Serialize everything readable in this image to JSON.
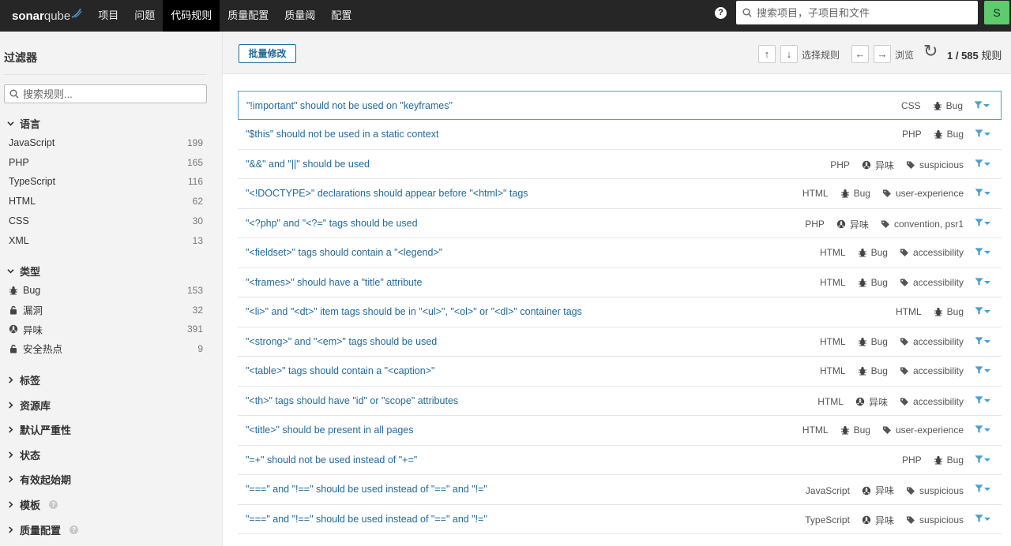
{
  "app": {
    "logo_main": "sonar",
    "logo_qube": "qube"
  },
  "nav": {
    "items": [
      "项目",
      "问题",
      "代码规则",
      "质量配置",
      "质量阈",
      "配置"
    ],
    "active_index": 2,
    "search_placeholder": "搜索项目，子项目和文件",
    "avatar_letter": "S",
    "help": "?"
  },
  "sidebar": {
    "title": "过滤器",
    "search_placeholder": "搜索规则...",
    "language": {
      "title": "语言",
      "items": [
        {
          "label": "JavaScript",
          "count": "199"
        },
        {
          "label": "PHP",
          "count": "165"
        },
        {
          "label": "TypeScript",
          "count": "116"
        },
        {
          "label": "HTML",
          "count": "62"
        },
        {
          "label": "CSS",
          "count": "30"
        },
        {
          "label": "XML",
          "count": "13"
        }
      ]
    },
    "type": {
      "title": "类型",
      "items": [
        {
          "label": "Bug",
          "count": "153",
          "icon": "bug-icon"
        },
        {
          "label": "漏洞",
          "count": "32",
          "icon": "lock-icon"
        },
        {
          "label": "异味",
          "count": "391",
          "icon": "code-smell-icon"
        },
        {
          "label": "安全热点",
          "count": "9",
          "icon": "lock-icon"
        }
      ]
    },
    "collapsed_facets": [
      "标签",
      "资源库",
      "默认严重性",
      "状态",
      "有效起始期",
      "模板",
      "质量配置"
    ]
  },
  "toolbar": {
    "bulk_change": "批量修改",
    "up": "↑",
    "down": "↓",
    "select_rules": "选择规则",
    "left": "←",
    "right": "→",
    "browse": "浏览",
    "page_position": "1 / 585",
    "rules_unit": "规则"
  },
  "rules": [
    {
      "name": "\"!important\" should not be used on \"keyframes\"",
      "lang": "CSS",
      "type": "Bug",
      "tags": ""
    },
    {
      "name": "\"$this\" should not be used in a static context",
      "lang": "PHP",
      "type": "Bug",
      "tags": ""
    },
    {
      "name": "\"&&\" and \"||\" should be used",
      "lang": "PHP",
      "type": "异味",
      "tags": "suspicious"
    },
    {
      "name": "\"<!DOCTYPE>\" declarations should appear before \"<html>\" tags",
      "lang": "HTML",
      "type": "Bug",
      "tags": "user-experience"
    },
    {
      "name": "\"<?php\" and \"<?=\" tags should be used",
      "lang": "PHP",
      "type": "异味",
      "tags": "convention, psr1"
    },
    {
      "name": "\"<fieldset>\" tags should contain a \"<legend>\"",
      "lang": "HTML",
      "type": "Bug",
      "tags": "accessibility"
    },
    {
      "name": "\"<frames>\" should have a \"title\" attribute",
      "lang": "HTML",
      "type": "Bug",
      "tags": "accessibility"
    },
    {
      "name": "\"<li>\" and \"<dt>\" item tags should be in \"<ul>\", \"<ol>\" or \"<dl>\" container tags",
      "lang": "HTML",
      "type": "Bug",
      "tags": ""
    },
    {
      "name": "\"<strong>\" and \"<em>\" tags should be used",
      "lang": "HTML",
      "type": "Bug",
      "tags": "accessibility"
    },
    {
      "name": "\"<table>\" tags should contain a \"<caption>\"",
      "lang": "HTML",
      "type": "Bug",
      "tags": "accessibility"
    },
    {
      "name": "\"<th>\" tags should have \"id\" or \"scope\" attributes",
      "lang": "HTML",
      "type": "异味",
      "tags": "accessibility"
    },
    {
      "name": "\"<title>\" should be present in all pages",
      "lang": "HTML",
      "type": "Bug",
      "tags": "user-experience"
    },
    {
      "name": "\"=+\" should not be used instead of \"+=\"",
      "lang": "PHP",
      "type": "Bug",
      "tags": ""
    },
    {
      "name": "\"===\" and \"!==\" should be used instead of \"==\" and \"!=\"",
      "lang": "JavaScript",
      "type": "异味",
      "tags": "suspicious"
    },
    {
      "name": "\"===\" and \"!==\" should be used instead of \"==\" and \"!=\"",
      "lang": "TypeScript",
      "type": "异味",
      "tags": "suspicious"
    }
  ],
  "colors": {
    "nav_bg": "#262626",
    "link": "#236a97",
    "accent": "#4b9fd5",
    "avatar": "#5ecb6c"
  }
}
